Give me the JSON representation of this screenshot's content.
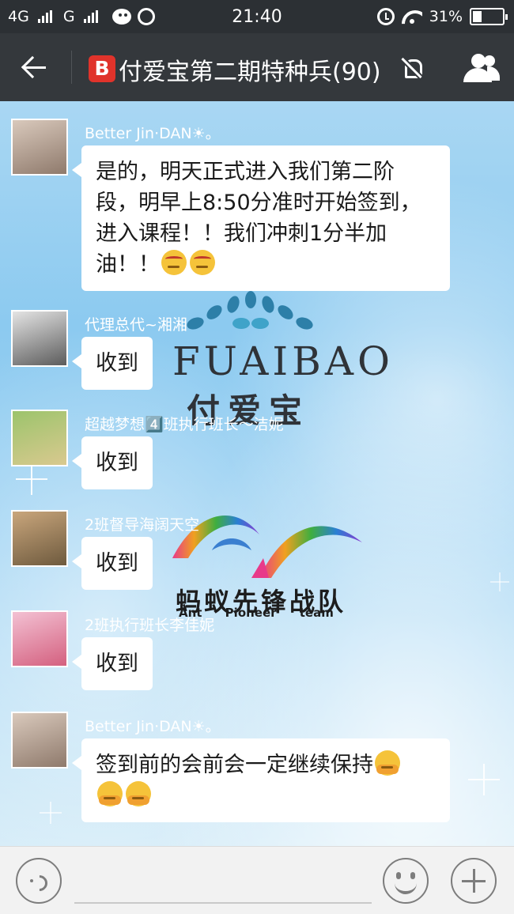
{
  "status_bar": {
    "network_1": "4G",
    "network_2": "G",
    "time": "21:40",
    "battery": "31%"
  },
  "header": {
    "title": "付爱宝第二期特种兵(90)",
    "badge": "B",
    "icons": [
      "back-arrow-icon",
      "mute-icon",
      "group-members-icon"
    ]
  },
  "watermark": {
    "brand_en": "FUAIBAO",
    "brand_cn": "付爱宝",
    "team_cn": "蚂蚁先锋战队",
    "team_en": "Ant Pioneer team"
  },
  "messages": [
    {
      "sender": "Better Jin·DAN☀。",
      "text": "是的，明天正式进入我们第二阶段，明早上8:50分准时开始签到，进入课程！！我们冲刺1分半加油！！",
      "emoji": [
        "determined-face-emoji",
        "determined-face-emoji"
      ],
      "avatar_color": "#c9b6a8"
    },
    {
      "sender": "代理总代~湘湘",
      "text": "收到",
      "emoji": [],
      "avatar_color": "#9a9a9a"
    },
    {
      "sender": "超越梦想4️⃣班执行班长～洁妮",
      "text": "收到",
      "emoji": [],
      "avatar_color": "#6f9a4e"
    },
    {
      "sender": "2班督导海阔天空",
      "text": "收到",
      "emoji": [],
      "avatar_color": "#b08864"
    },
    {
      "sender": "2班执行班长李佳妮",
      "text": "收到",
      "emoji": [],
      "avatar_color": "#e69ab8"
    },
    {
      "sender": "Better Jin·DAN☀。",
      "text": "签到前的会前会一定继续保持",
      "emoji": [
        "giggle-face-emoji",
        "giggle-face-emoji",
        "giggle-face-emoji"
      ],
      "avatar_color": "#c9b6a8"
    }
  ],
  "input_bar": {
    "icons": [
      "voice-icon",
      "emoji-icon",
      "plus-icon"
    ]
  }
}
